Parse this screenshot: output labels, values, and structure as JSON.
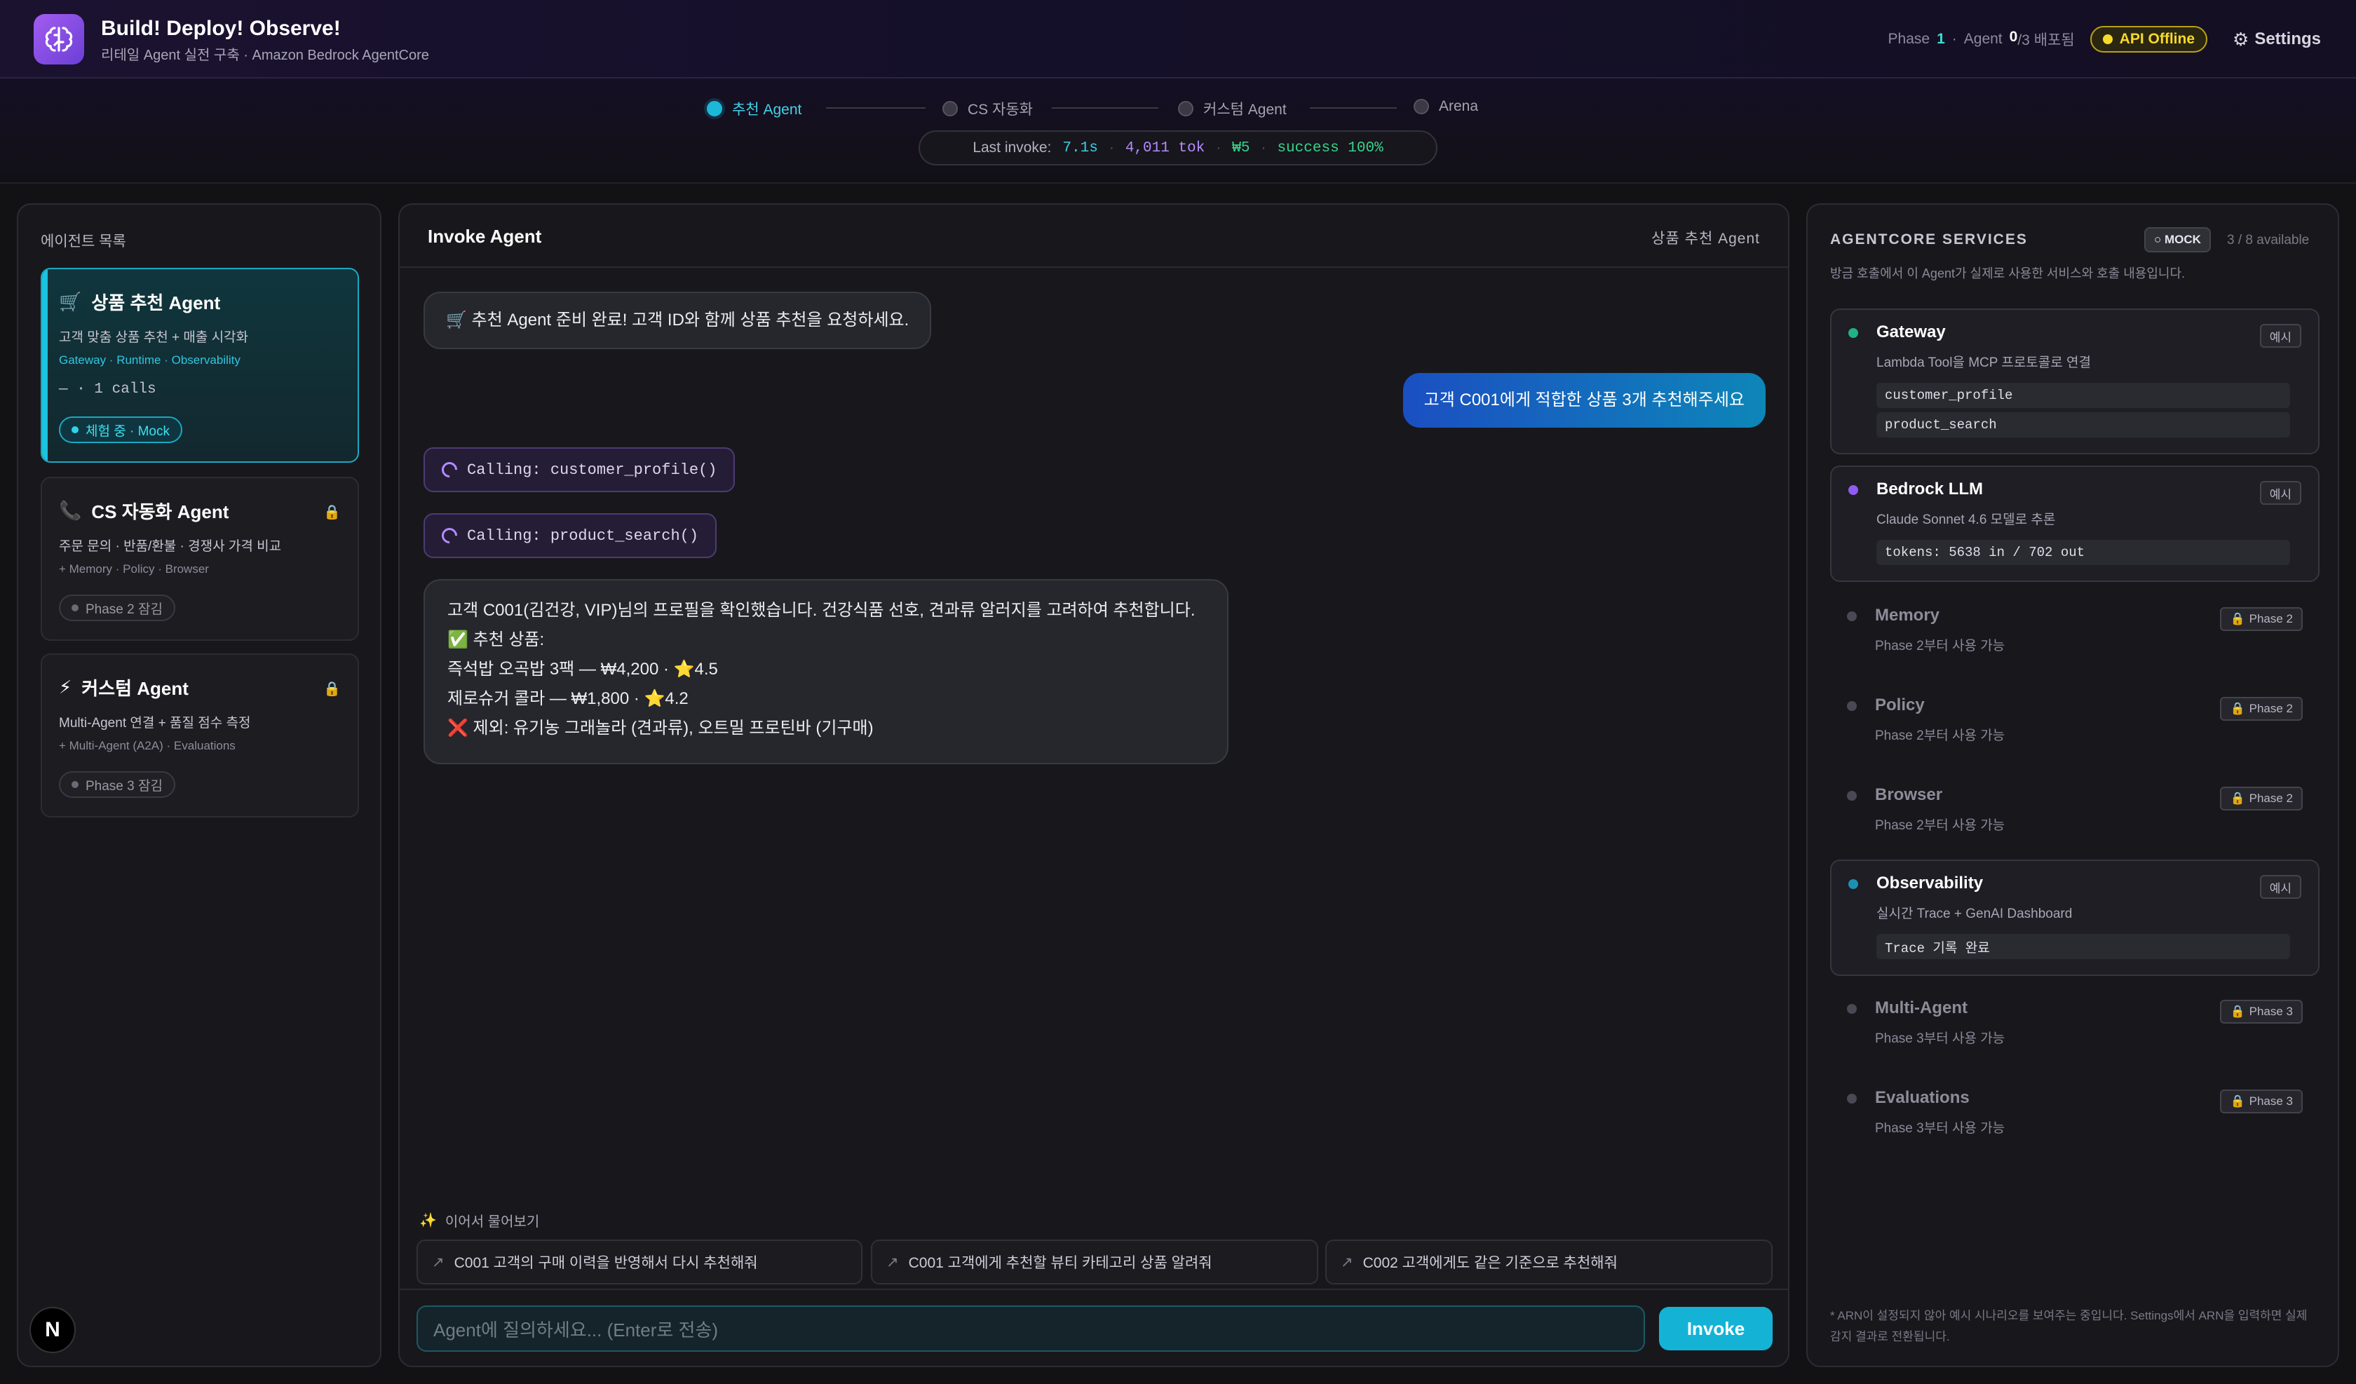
{
  "header": {
    "title": "Build! Deploy! Observe!",
    "subtitle": "리테일 Agent 실전 구축 · Amazon Bedrock AgentCore",
    "phase_label": "Phase",
    "phase_value": "1",
    "dot_sep": "·",
    "agent_label": "Agent",
    "agent_deployed": "0",
    "agent_total_suffix": "/3 배포됨",
    "api_status": "API Offline",
    "settings_label": "Settings"
  },
  "stepper": {
    "steps": [
      {
        "label": "추천 Agent",
        "active": true
      },
      {
        "label": "CS 자동화",
        "active": false
      },
      {
        "label": "커스텀 Agent",
        "active": false
      },
      {
        "label": "Arena",
        "active": false
      }
    ]
  },
  "invoke_stats": {
    "label": "Last invoke:",
    "latency": "7.1s",
    "tokens": "4,011 tok",
    "cost": "₩5",
    "success": "success 100%",
    "sep": "·"
  },
  "left_panel": {
    "title": "에이전트 목록",
    "agents": [
      {
        "icon": "🛒",
        "name": "상품 추천 Agent",
        "desc": "고객 맞춤 상품 추천 + 매출 시각화",
        "tags": "Gateway · Runtime · Observability",
        "calls": "— · 1 calls",
        "status": "체험 중 · Mock"
      },
      {
        "icon": "📞",
        "name": "CS 자동화 Agent",
        "desc": "주문 문의 · 반품/환불 · 경쟁사 가격 비교",
        "tags": "+ Memory · Policy · Browser",
        "status": "Phase 2 잠김"
      },
      {
        "icon": "⚡",
        "name": "커스텀 Agent",
        "desc": "Multi-Agent 연결 + 품질 점수 측정",
        "tags": "+ Multi-Agent (A2A) · Evaluations",
        "status": "Phase 3 잠김"
      }
    ],
    "n_badge": "N"
  },
  "chat": {
    "title": "Invoke Agent",
    "agent_name": "상품 추천 Agent",
    "messages": {
      "greeting": "🛒 추천 Agent 준비 완료! 고객 ID와 함께 상품 추천을 요청하세요.",
      "user": "고객 C001에게 적합한 상품 3개 추천해주세요",
      "tool1": "Calling: customer_profile()",
      "tool2": "Calling: product_search()",
      "answer_lines": [
        "고객 C001(김건강, VIP)님의 프로필을 확인했습니다. 건강식품 선호, 견과류 알러지를 고려하여 추천합니다.",
        "✅ 추천 상품:",
        "즉석밥 오곡밥 3팩 — ₩4,200 · ⭐4.5",
        "제로슈거 콜라 — ₩1,800 · ⭐4.2",
        "❌ 제외: 유기농 그래놀라 (견과류), 오트밀 프로틴바 (기구매)"
      ]
    },
    "followup_label": "이어서 물어보기",
    "followups": [
      "C001 고객의 구매 이력을 반영해서 다시 추천해줘",
      "C001 고객에게 추천할 뷰티 카테고리 상품 알려줘",
      "C002 고객에게도 같은 기준으로 추천해줘"
    ],
    "input_placeholder": "Agent에 질의하세요... (Enter로 전송)",
    "invoke_button": "Invoke"
  },
  "services": {
    "title": "AGENTCORE SERVICES",
    "mock_badge": "○ MOCK",
    "available": "3 / 8 available",
    "desc": "방금 호출에서 이 Agent가 실제로 사용한 서비스와 호출 내용입니다.",
    "items": [
      {
        "name": "Gateway",
        "sub": "Lambda Tool을 MCP 프로토콜로 연결",
        "tag": "예시",
        "codes": [
          "customer_profile",
          "product_search"
        ],
        "color": "#1fb383"
      },
      {
        "name": "Bedrock LLM",
        "sub": "Claude Sonnet 4.6 모델로 추론",
        "tag": "예시",
        "codes": [
          "tokens: 5638 in / 702 out"
        ],
        "color": "#8f5bf0"
      },
      {
        "name": "Memory",
        "sub": "Phase 2부터 사용 가능",
        "tag": "Phase 2"
      },
      {
        "name": "Policy",
        "sub": "Phase 2부터 사용 가능",
        "tag": "Phase 2"
      },
      {
        "name": "Browser",
        "sub": "Phase 2부터 사용 가능",
        "tag": "Phase 2"
      },
      {
        "name": "Observability",
        "sub": "실시간 Trace + GenAI Dashboard",
        "tag": "예시",
        "codes": [
          "Trace 기록 완료"
        ],
        "color": "#1e8fb3"
      },
      {
        "name": "Multi-Agent",
        "sub": "Phase 3부터 사용 가능",
        "tag": "Phase 3"
      },
      {
        "name": "Evaluations",
        "sub": "Phase 3부터 사용 가능",
        "tag": "Phase 3"
      }
    ],
    "footnote": "* ARN이 설정되지 않아 예시 시나리오를 보여주는 중입니다. Settings에서 ARN을 입력하면 실제 감지 결과로 전환됩니다."
  },
  "colors": {
    "accent_cyan": "#14b3d6",
    "warning_yellow": "#f6d92b",
    "purple": "#b58bff",
    "success_green": "#35d38a"
  }
}
